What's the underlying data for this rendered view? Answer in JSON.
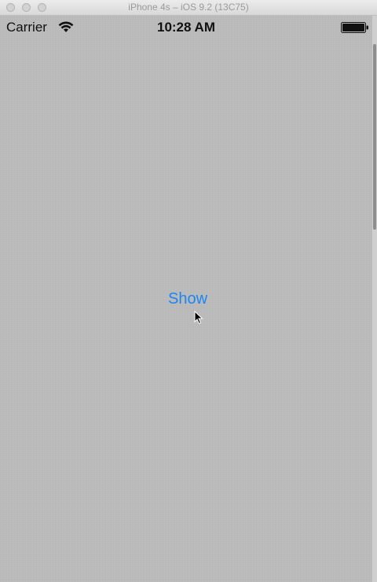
{
  "window": {
    "title": "iPhone 4s – iOS 9.2 (13C75)"
  },
  "status_bar": {
    "carrier": "Carrier",
    "time": "10:28 AM",
    "wifi_icon": "wifi-icon",
    "battery_icon": "battery-icon"
  },
  "main": {
    "show_label": "Show"
  },
  "colors": {
    "background": "#bcbcbc",
    "accent": "#1b86f2"
  }
}
